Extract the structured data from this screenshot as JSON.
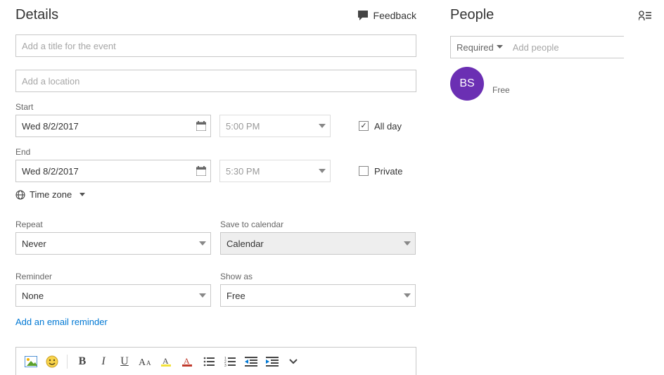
{
  "details": {
    "heading": "Details",
    "feedback_label": "Feedback",
    "title_placeholder": "Add a title for the event",
    "location_placeholder": "Add a location",
    "start_label": "Start",
    "start_date": "Wed 8/2/2017",
    "start_time": "5:00 PM",
    "allday_label": "All day",
    "allday_checked": true,
    "end_label": "End",
    "end_date": "Wed 8/2/2017",
    "end_time": "5:30 PM",
    "private_label": "Private",
    "private_checked": false,
    "timezone_label": "Time zone",
    "repeat_label": "Repeat",
    "repeat_value": "Never",
    "save_to_label": "Save to calendar",
    "save_to_value": "Calendar",
    "reminder_label": "Reminder",
    "reminder_value": "None",
    "showas_label": "Show as",
    "showas_value": "Free",
    "email_reminder_link": "Add an email reminder"
  },
  "people": {
    "heading": "People",
    "required_label": "Required",
    "add_placeholder": "Add people",
    "avatar_initials": "BS",
    "status": "Free"
  },
  "toolbar": {
    "bold": "B",
    "italic": "I",
    "underline": "U"
  }
}
